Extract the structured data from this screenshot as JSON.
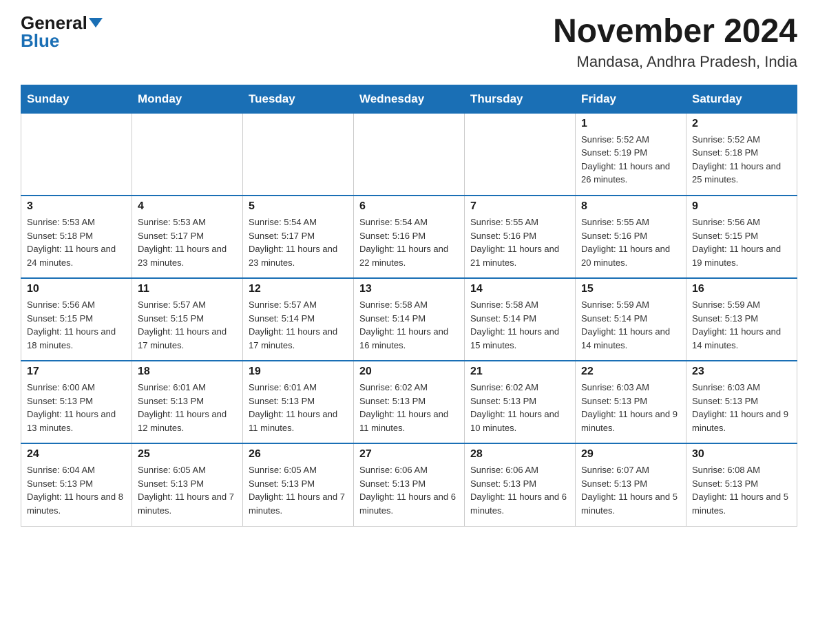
{
  "header": {
    "logo_general": "General",
    "logo_blue": "Blue",
    "month_year": "November 2024",
    "location": "Mandasa, Andhra Pradesh, India"
  },
  "days_of_week": [
    "Sunday",
    "Monday",
    "Tuesday",
    "Wednesday",
    "Thursday",
    "Friday",
    "Saturday"
  ],
  "weeks": [
    [
      {
        "day": "",
        "info": ""
      },
      {
        "day": "",
        "info": ""
      },
      {
        "day": "",
        "info": ""
      },
      {
        "day": "",
        "info": ""
      },
      {
        "day": "",
        "info": ""
      },
      {
        "day": "1",
        "info": "Sunrise: 5:52 AM\nSunset: 5:19 PM\nDaylight: 11 hours and 26 minutes."
      },
      {
        "day": "2",
        "info": "Sunrise: 5:52 AM\nSunset: 5:18 PM\nDaylight: 11 hours and 25 minutes."
      }
    ],
    [
      {
        "day": "3",
        "info": "Sunrise: 5:53 AM\nSunset: 5:18 PM\nDaylight: 11 hours and 24 minutes."
      },
      {
        "day": "4",
        "info": "Sunrise: 5:53 AM\nSunset: 5:17 PM\nDaylight: 11 hours and 23 minutes."
      },
      {
        "day": "5",
        "info": "Sunrise: 5:54 AM\nSunset: 5:17 PM\nDaylight: 11 hours and 23 minutes."
      },
      {
        "day": "6",
        "info": "Sunrise: 5:54 AM\nSunset: 5:16 PM\nDaylight: 11 hours and 22 minutes."
      },
      {
        "day": "7",
        "info": "Sunrise: 5:55 AM\nSunset: 5:16 PM\nDaylight: 11 hours and 21 minutes."
      },
      {
        "day": "8",
        "info": "Sunrise: 5:55 AM\nSunset: 5:16 PM\nDaylight: 11 hours and 20 minutes."
      },
      {
        "day": "9",
        "info": "Sunrise: 5:56 AM\nSunset: 5:15 PM\nDaylight: 11 hours and 19 minutes."
      }
    ],
    [
      {
        "day": "10",
        "info": "Sunrise: 5:56 AM\nSunset: 5:15 PM\nDaylight: 11 hours and 18 minutes."
      },
      {
        "day": "11",
        "info": "Sunrise: 5:57 AM\nSunset: 5:15 PM\nDaylight: 11 hours and 17 minutes."
      },
      {
        "day": "12",
        "info": "Sunrise: 5:57 AM\nSunset: 5:14 PM\nDaylight: 11 hours and 17 minutes."
      },
      {
        "day": "13",
        "info": "Sunrise: 5:58 AM\nSunset: 5:14 PM\nDaylight: 11 hours and 16 minutes."
      },
      {
        "day": "14",
        "info": "Sunrise: 5:58 AM\nSunset: 5:14 PM\nDaylight: 11 hours and 15 minutes."
      },
      {
        "day": "15",
        "info": "Sunrise: 5:59 AM\nSunset: 5:14 PM\nDaylight: 11 hours and 14 minutes."
      },
      {
        "day": "16",
        "info": "Sunrise: 5:59 AM\nSunset: 5:13 PM\nDaylight: 11 hours and 14 minutes."
      }
    ],
    [
      {
        "day": "17",
        "info": "Sunrise: 6:00 AM\nSunset: 5:13 PM\nDaylight: 11 hours and 13 minutes."
      },
      {
        "day": "18",
        "info": "Sunrise: 6:01 AM\nSunset: 5:13 PM\nDaylight: 11 hours and 12 minutes."
      },
      {
        "day": "19",
        "info": "Sunrise: 6:01 AM\nSunset: 5:13 PM\nDaylight: 11 hours and 11 minutes."
      },
      {
        "day": "20",
        "info": "Sunrise: 6:02 AM\nSunset: 5:13 PM\nDaylight: 11 hours and 11 minutes."
      },
      {
        "day": "21",
        "info": "Sunrise: 6:02 AM\nSunset: 5:13 PM\nDaylight: 11 hours and 10 minutes."
      },
      {
        "day": "22",
        "info": "Sunrise: 6:03 AM\nSunset: 5:13 PM\nDaylight: 11 hours and 9 minutes."
      },
      {
        "day": "23",
        "info": "Sunrise: 6:03 AM\nSunset: 5:13 PM\nDaylight: 11 hours and 9 minutes."
      }
    ],
    [
      {
        "day": "24",
        "info": "Sunrise: 6:04 AM\nSunset: 5:13 PM\nDaylight: 11 hours and 8 minutes."
      },
      {
        "day": "25",
        "info": "Sunrise: 6:05 AM\nSunset: 5:13 PM\nDaylight: 11 hours and 7 minutes."
      },
      {
        "day": "26",
        "info": "Sunrise: 6:05 AM\nSunset: 5:13 PM\nDaylight: 11 hours and 7 minutes."
      },
      {
        "day": "27",
        "info": "Sunrise: 6:06 AM\nSunset: 5:13 PM\nDaylight: 11 hours and 6 minutes."
      },
      {
        "day": "28",
        "info": "Sunrise: 6:06 AM\nSunset: 5:13 PM\nDaylight: 11 hours and 6 minutes."
      },
      {
        "day": "29",
        "info": "Sunrise: 6:07 AM\nSunset: 5:13 PM\nDaylight: 11 hours and 5 minutes."
      },
      {
        "day": "30",
        "info": "Sunrise: 6:08 AM\nSunset: 5:13 PM\nDaylight: 11 hours and 5 minutes."
      }
    ]
  ]
}
